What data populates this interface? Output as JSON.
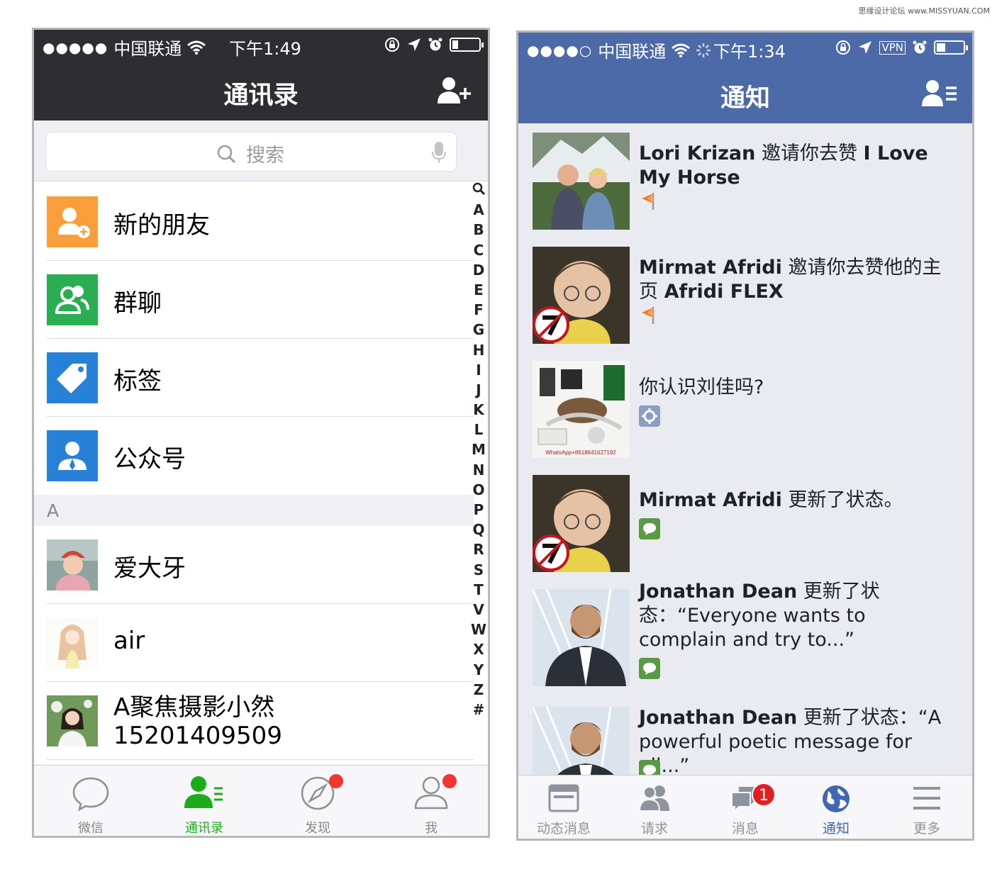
{
  "watermark": "思缘设计论坛 www.MISSYUAN.COM",
  "wechat": {
    "status": {
      "signal": "●●●●●",
      "carrier": "中国联通",
      "time": "下午1:49"
    },
    "title": "通讯录",
    "search_placeholder": "搜索",
    "top_items": [
      {
        "label": "新的朋友",
        "icon": "new-friend-icon",
        "color": "#fa9d3b"
      },
      {
        "label": "群聊",
        "icon": "group-chat-icon",
        "color": "#2bad52"
      },
      {
        "label": "标签",
        "icon": "tag-icon",
        "color": "#2782d7"
      },
      {
        "label": "公众号",
        "icon": "official-account-icon",
        "color": "#2782d7"
      }
    ],
    "section_header": "A",
    "contacts": [
      {
        "name": "爱大牙"
      },
      {
        "name": "air"
      },
      {
        "name": "A聚焦摄影小然",
        "sub": "15201409509"
      }
    ],
    "index": [
      "Q",
      "A",
      "B",
      "C",
      "D",
      "E",
      "F",
      "G",
      "H",
      "I",
      "J",
      "K",
      "L",
      "M",
      "N",
      "O",
      "P",
      "Q",
      "R",
      "S",
      "T",
      "V",
      "W",
      "X",
      "Y",
      "Z",
      "#"
    ],
    "tabs": [
      {
        "label": "微信",
        "icon": "chat-bubble-icon",
        "active": false
      },
      {
        "label": "通讯录",
        "icon": "contacts-icon",
        "active": true
      },
      {
        "label": "发现",
        "icon": "compass-icon",
        "active": false
      },
      {
        "label": "我",
        "icon": "person-icon",
        "active": false
      }
    ],
    "active_color": "#1aad19"
  },
  "facebook": {
    "status": {
      "signal": "●●●●○",
      "carrier": "中国联通",
      "time": "下午1:34",
      "vpn": "VPN"
    },
    "title": "通知",
    "notifications": [
      {
        "name": "Lori Krizan",
        "text": " 邀请你去赞 ",
        "bold2": "I Love My Horse",
        "icon": "flag-icon"
      },
      {
        "name": "Mirmat Afridi",
        "text": " 邀请你去赞他的主页 ",
        "bold2": "Afridi FLEX",
        "icon": "flag-icon"
      },
      {
        "name": "",
        "text": "你认识刘佳吗?",
        "bold2": "",
        "icon": "gear-icon"
      },
      {
        "name": "Mirmat Afridi",
        "text": " 更新了状态。",
        "bold2": "",
        "icon": "comment-icon"
      },
      {
        "name": "Jonathan Dean",
        "text": " 更新了状态：“Everyone wants to complain and try to...”",
        "bold2": "",
        "icon": "comment-icon"
      },
      {
        "name": "Jonathan Dean",
        "text": " 更新了状态：“A powerful poetic message for all...”",
        "bold2": "",
        "icon": "comment-icon"
      }
    ],
    "thumb_caption": "WhatsApp+8618641627192",
    "tabs": [
      {
        "label": "动态消息",
        "icon": "news-feed-icon",
        "active": false
      },
      {
        "label": "请求",
        "icon": "friend-requests-icon",
        "active": false
      },
      {
        "label": "消息",
        "icon": "messages-icon",
        "active": false,
        "badge": "1"
      },
      {
        "label": "通知",
        "icon": "globe-icon",
        "active": true
      },
      {
        "label": "更多",
        "icon": "menu-icon",
        "active": false
      }
    ],
    "active_color": "#4267b2"
  }
}
